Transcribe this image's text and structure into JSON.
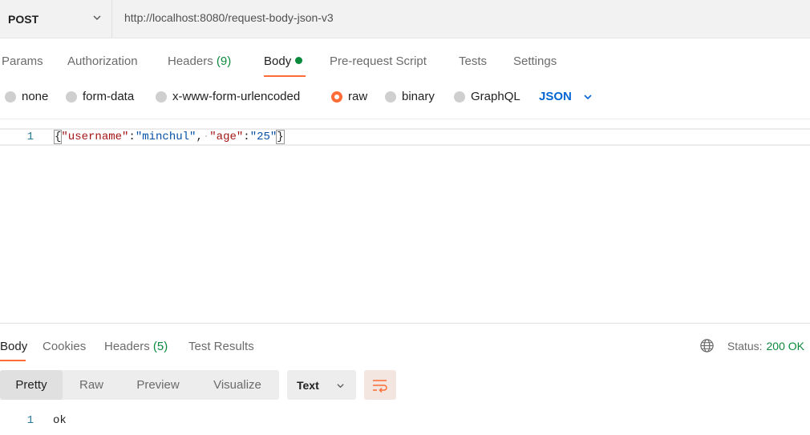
{
  "request": {
    "method": "POST",
    "url": "http://localhost:8080/request-body-json-v3"
  },
  "request_tabs": [
    {
      "label": "Params"
    },
    {
      "label": "Authorization"
    },
    {
      "label": "Headers",
      "count": "(9)"
    },
    {
      "label": "Body",
      "active": true
    },
    {
      "label": "Pre-request Script"
    },
    {
      "label": "Tests"
    },
    {
      "label": "Settings"
    }
  ],
  "body_types": {
    "options": [
      "none",
      "form-data",
      "x-www-form-urlencoded",
      "raw",
      "binary",
      "GraphQL"
    ],
    "selected": "raw",
    "language": "JSON"
  },
  "editor": {
    "line_number": "1",
    "tokens": {
      "open": "{",
      "key1": "\"username\"",
      "colon1": ":",
      "val1": "\"minchul\"",
      "comma": ",",
      "space_marker": "·",
      "key2": "\"age\"",
      "colon2": ":",
      "val2": "\"25\"",
      "close": "}"
    }
  },
  "response_tabs": [
    {
      "label": "Body",
      "active": true
    },
    {
      "label": "Cookies"
    },
    {
      "label": "Headers",
      "count": "(5)"
    },
    {
      "label": "Test Results"
    }
  ],
  "status": {
    "label": "Status:",
    "value": "200 OK"
  },
  "response_view": {
    "modes": [
      "Pretty",
      "Raw",
      "Preview",
      "Visualize"
    ],
    "active_mode": "Pretty",
    "format": "Text",
    "line_number": "1",
    "content": "ok"
  },
  "colors": {
    "accent": "#ff6c37",
    "success": "#0b8a3e",
    "link_blue": "#0265d2"
  }
}
